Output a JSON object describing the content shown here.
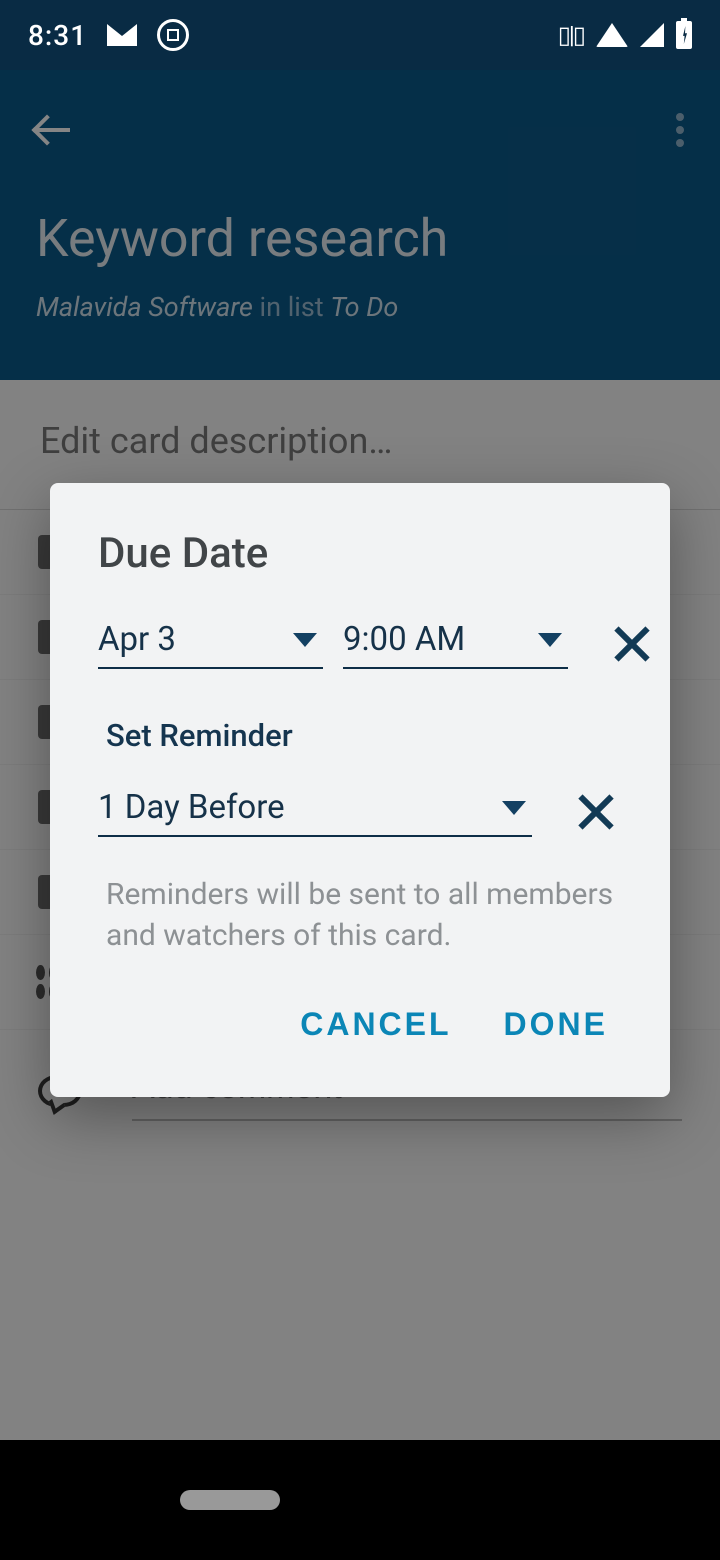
{
  "status": {
    "time": "8:31"
  },
  "header": {
    "title": "Keyword research",
    "board": "Malavida Software",
    "sep": "in list",
    "list": "To Do"
  },
  "body": {
    "desc_placeholder": "Edit card description…",
    "comment_placeholder": "Add comment"
  },
  "dialog": {
    "title": "Due Date",
    "date": "Apr 3",
    "time": "9:00 AM",
    "reminder_label": "Set Reminder",
    "reminder_value": "1 Day Before",
    "helper": "Reminders will be sent to all members and watchers of this card.",
    "cancel": "CANCEL",
    "done": "DONE"
  }
}
